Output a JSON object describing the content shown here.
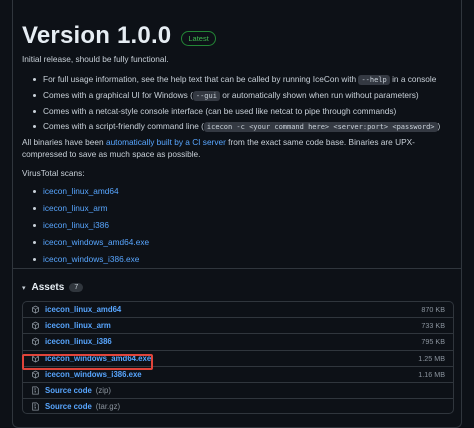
{
  "release": {
    "title": "Version 1.0.0",
    "badge": "Latest",
    "intro": "Initial release, should be fully functional.",
    "bullets": [
      {
        "pre": "For full usage information, see the help text that can be called by running IceCon with ",
        "code": "--help",
        "post": " in a console"
      },
      {
        "pre": "Comes with a graphical UI for Windows (",
        "code": "--gui",
        "post": " or automatically shown when run without parameters)"
      },
      {
        "pre": "Comes with a netcat-style console interface (can be used like netcat to pipe through commands)",
        "code": "",
        "post": ""
      },
      {
        "pre": "Comes with a script-friendly command line (",
        "code": "icecon -c <your command here> <server:port> <password>",
        "post": ")"
      }
    ],
    "binaries_pre": "All binaries have been ",
    "binaries_link": "automatically built by a CI server",
    "binaries_post": " from the exact same code base. Binaries are UPX-compressed to save as much space as possible.",
    "virustotal_label": "VirusTotal scans:",
    "virustotal_links": [
      "icecon_linux_amd64",
      "icecon_linux_arm",
      "icecon_linux_i386",
      "icecon_windows_amd64.exe",
      "icecon_windows_i386.exe"
    ]
  },
  "assets": {
    "caret": "▾",
    "title": "Assets",
    "count": "7",
    "items": [
      {
        "name": "icecon_linux_amd64",
        "ext": "",
        "size": "870 KB",
        "icon": "package-icon"
      },
      {
        "name": "icecon_linux_arm",
        "ext": "",
        "size": "733 KB",
        "icon": "package-icon"
      },
      {
        "name": "icecon_linux_i386",
        "ext": "",
        "size": "795 KB",
        "icon": "package-icon"
      },
      {
        "name": "icecon_windows_amd64.exe",
        "ext": "",
        "size": "1.25 MB",
        "icon": "package-icon"
      },
      {
        "name": "icecon_windows_i386.exe",
        "ext": "",
        "size": "1.16 MB",
        "icon": "package-icon"
      },
      {
        "name": "Source code",
        "ext": "(zip)",
        "size": "",
        "icon": "file-zip-icon"
      },
      {
        "name": "Source code",
        "ext": "(tar.gz)",
        "size": "",
        "icon": "file-zip-icon"
      }
    ],
    "highlighted_index": 3,
    "highlight_color": "#e0443a"
  },
  "colors": {
    "link": "#58a6ff",
    "background": "#0d1117",
    "latest_badge": "#3fb950"
  }
}
